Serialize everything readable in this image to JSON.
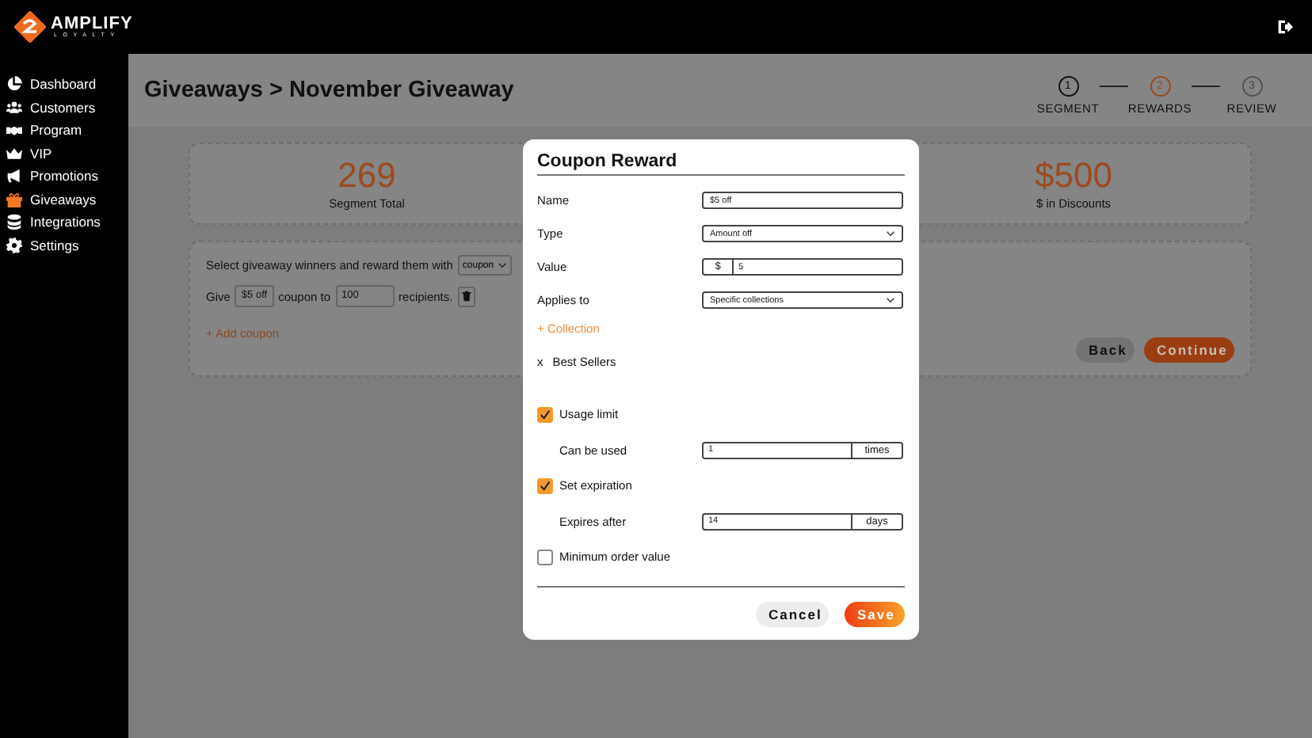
{
  "brand": {
    "name": "AMPLIFY",
    "tagline": "LOYALTY"
  },
  "sidebar": {
    "items": [
      {
        "label": "Dashboard",
        "kind": "pie",
        "selected": false
      },
      {
        "label": "Customers",
        "kind": "people",
        "selected": false
      },
      {
        "label": "Program",
        "kind": "handshake",
        "selected": false
      },
      {
        "label": "VIP",
        "kind": "crown",
        "selected": false
      },
      {
        "label": "Promotions",
        "kind": "megaphone",
        "selected": false
      },
      {
        "label": "Giveaways",
        "kind": "gift",
        "selected": true
      },
      {
        "label": "Integrations",
        "kind": "stack",
        "selected": false
      },
      {
        "label": "Settings",
        "kind": "gear",
        "selected": false
      }
    ]
  },
  "page": {
    "title": "Giveaways > November Giveaway"
  },
  "stepper": [
    {
      "number": "1",
      "label": "SEGMENT",
      "selected": false,
      "done": true
    },
    {
      "number": "2",
      "label": "REWARDS",
      "selected": true,
      "done": false
    },
    {
      "number": "3",
      "label": "REVIEW",
      "selected": false,
      "done": false
    }
  ],
  "stats": [
    {
      "value": "269",
      "label": "Segment Total"
    },
    {
      "value": "$500",
      "label": "$ in Discounts"
    }
  ],
  "rewards": {
    "intro": "Select giveaway winners and reward them with",
    "reward_type": "coupon",
    "line": {
      "prefix": "Give",
      "coupon": "$5 off",
      "middle": "coupon to",
      "count": "100",
      "suffix": "recipients."
    },
    "add_link": "+ Add coupon",
    "buttons": [
      {
        "label": "Back",
        "kind": "secondary"
      },
      {
        "label": "Continue",
        "kind": "primary"
      }
    ]
  },
  "modal": {
    "title": "Coupon Reward",
    "fields": [
      {
        "kind": "text",
        "label": "Name",
        "value": "$5 off"
      },
      {
        "kind": "select",
        "label": "Type",
        "value": "Amount off"
      },
      {
        "kind": "prefixed",
        "label": "Value",
        "prefix": "$",
        "value": "5"
      },
      {
        "kind": "select",
        "label": "Applies to",
        "value": "Specific collections"
      },
      {
        "kind": "link",
        "label": "+ Collection"
      },
      {
        "kind": "tag",
        "remove": "x",
        "label": "Best Sellers"
      },
      {
        "kind": "checkbox",
        "label": "Usage limit",
        "checked": true
      },
      {
        "kind": "suffixed",
        "label": "Can be used",
        "value": "1",
        "suffix": "times"
      },
      {
        "kind": "checkbox",
        "label": "Set expiration",
        "checked": true
      },
      {
        "kind": "suffixed",
        "label": "Expires after",
        "value": "14",
        "suffix": "days"
      },
      {
        "kind": "checkbox",
        "label": "Minimum order value",
        "checked": false
      }
    ],
    "buttons": [
      {
        "label": "Cancel",
        "kind": "secondary"
      },
      {
        "label": "Save",
        "kind": "primary"
      }
    ]
  }
}
